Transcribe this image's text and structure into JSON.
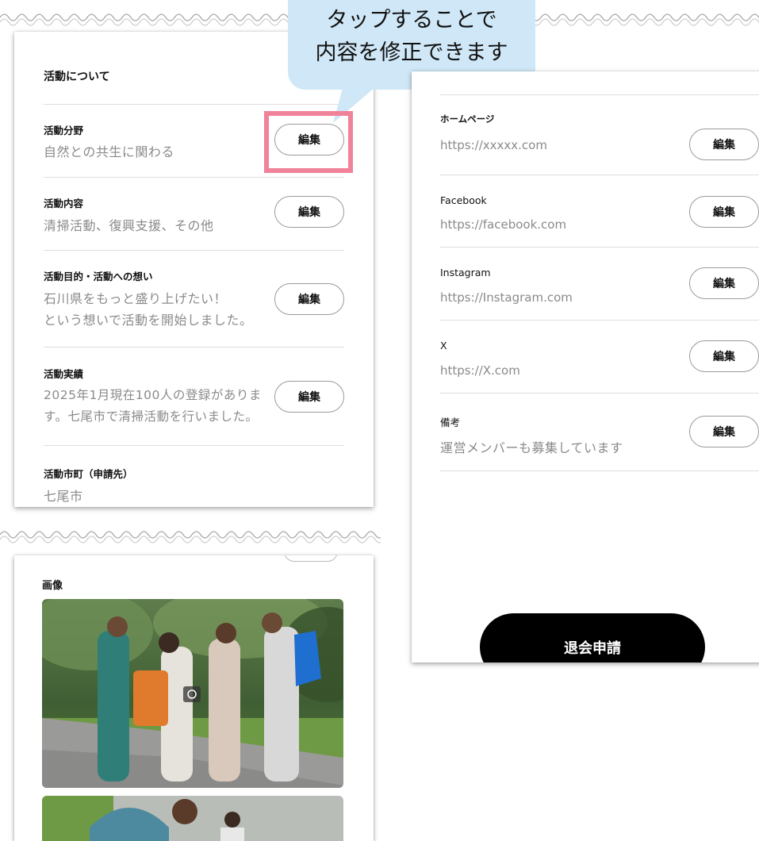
{
  "callout": {
    "line1": "タップすることで",
    "line2": "内容を修正できます"
  },
  "left_card": {
    "title": "活動について",
    "edit_label": "編集",
    "rows": [
      {
        "label": "活動分野",
        "value_lines": [
          "自然との共生に関わる"
        ],
        "editable": true
      },
      {
        "label": "活動内容",
        "value_lines": [
          "清掃活動、復興支援、その他"
        ],
        "editable": true
      },
      {
        "label": "活動目的・活動への想い",
        "value_lines": [
          "石川県をもっと盛り上げたい！",
          "という想いで活動を開始しました。"
        ],
        "editable": true
      },
      {
        "label": "活動実績",
        "value_lines": [
          "2025年1月現在100人の登録がありま",
          "す。七尾市で清掃活動を行いました。"
        ],
        "editable": true
      },
      {
        "label": "活動市町（申請先）",
        "value_lines": [
          "七尾市"
        ],
        "editable": false
      }
    ]
  },
  "image_card": {
    "title": "画像",
    "photos": [
      {
        "alt": "group-photo-people-with-bags"
      },
      {
        "alt": "photo-people-outdoors"
      }
    ]
  },
  "right_card": {
    "edit_label": "編集",
    "rows": [
      {
        "label": "ホームページ",
        "value": "https://xxxxx.com"
      },
      {
        "label": "Facebook",
        "value": "https://facebook.com"
      },
      {
        "label": "Instagram",
        "value": "https://Instagram.com"
      },
      {
        "label": "X",
        "value": "https://X.com"
      },
      {
        "label": "備考",
        "value": "運営メンバーも募集しています"
      }
    ],
    "withdraw_label": "退会申請"
  },
  "colors": {
    "highlight": "#f0829a",
    "callout_bg": "#cfe7f6",
    "value_text": "#8a8a8a"
  }
}
